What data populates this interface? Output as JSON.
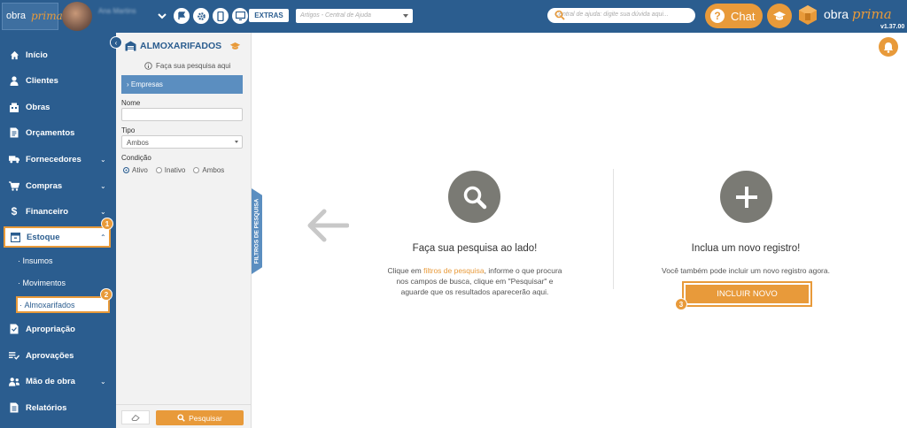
{
  "topbar": {
    "logo_text": "obra",
    "logo_script": "prima",
    "user_name": "Ana Martins",
    "extras_label": "EXTRAS",
    "help_placeholder": "Artigos - Central de Ajuda",
    "search_placeholder": "Central de ajuda: digite sua dúvida aqui...",
    "chat_label": "Chat",
    "brand_name": "obra",
    "brand_script": "prima",
    "version": "v1.37.00"
  },
  "sidebar": {
    "items": [
      {
        "label": "Início",
        "icon": "home-icon"
      },
      {
        "label": "Clientes",
        "icon": "user-icon"
      },
      {
        "label": "Obras",
        "icon": "building-icon"
      },
      {
        "label": "Orçamentos",
        "icon": "document-icon"
      },
      {
        "label": "Fornecedores",
        "icon": "truck-icon"
      },
      {
        "label": "Compras",
        "icon": "cart-icon"
      },
      {
        "label": "Financeiro",
        "icon": "dollar-icon"
      },
      {
        "label": "Estoque",
        "icon": "box-icon"
      },
      {
        "label": "Apropriação",
        "icon": "clipboard-icon"
      },
      {
        "label": "Aprovações",
        "icon": "check-list-icon"
      },
      {
        "label": "Mão de obra",
        "icon": "workers-icon"
      },
      {
        "label": "Relatórios",
        "icon": "report-icon"
      }
    ],
    "subitems": [
      {
        "label": "Insumos"
      },
      {
        "label": "Movimentos"
      },
      {
        "label": "Almoxarifados"
      }
    ],
    "badges": [
      "1",
      "2"
    ]
  },
  "filter": {
    "title": "ALMOXARIFADOS",
    "hint": "Faça sua pesquisa aqui",
    "empresas_label": "Empresas",
    "nome_label": "Nome",
    "nome_value": "",
    "tipo_label": "Tipo",
    "tipo_value": "Ambos",
    "condicao_label": "Condição",
    "radio_ativo": "Ativo",
    "radio_inativo": "Inativo",
    "radio_ambos": "Ambos",
    "pesquisar_label": "Pesquisar",
    "vertical_tab": "FILTROS DE PESQUISA"
  },
  "main": {
    "search_title": "Faça sua pesquisa ao lado!",
    "search_desc_pre": "Clique em ",
    "search_desc_link": "filtros de pesquisa",
    "search_desc_post": ", informe o que procura nos campos de busca, clique em \"Pesquisar\" e aguarde que os resultados aparecerão aqui.",
    "new_title": "Inclua um novo registro!",
    "new_desc": "Você também pode incluir um novo registro agora.",
    "incluir_label": "INCLUIR NOVO",
    "badge": "3"
  },
  "colors": {
    "primary": "#2b5d8f",
    "accent": "#e89a3a",
    "circle": "#7a7a74"
  }
}
